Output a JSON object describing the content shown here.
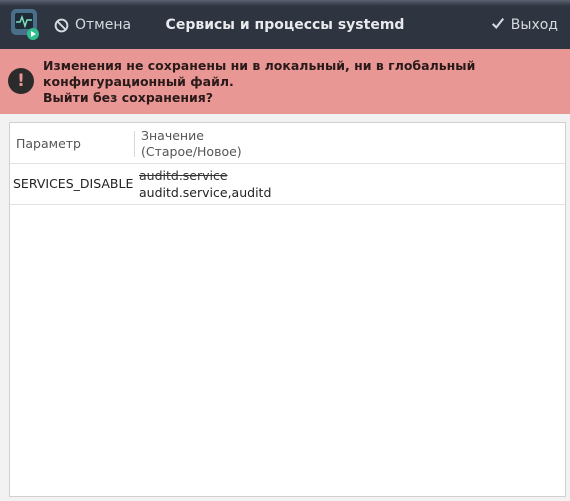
{
  "titlebar": {
    "title": "Сервисы и процессы systemd",
    "cancel_label": "Отмена",
    "exit_label": "Выход",
    "cancel_icon": "no-entry-icon",
    "exit_icon": "check-icon",
    "app_icon": "system-monitor-app-icon"
  },
  "warning": {
    "icon": "exclamation-icon",
    "line1": "Изменения не сохранены ни в локальный, ни в глобальный конфигурационный файл.",
    "line2": "Выйти без сохранения?",
    "background": "#e99794"
  },
  "table": {
    "columns": {
      "param": "Параметр",
      "value_line1": "Значение",
      "value_line2": "(Старое/Новое)"
    },
    "rows": [
      {
        "param": "SERVICES_DISABLE",
        "old_value": "auditd.service",
        "new_value": "auditd.service,auditd"
      }
    ]
  }
}
